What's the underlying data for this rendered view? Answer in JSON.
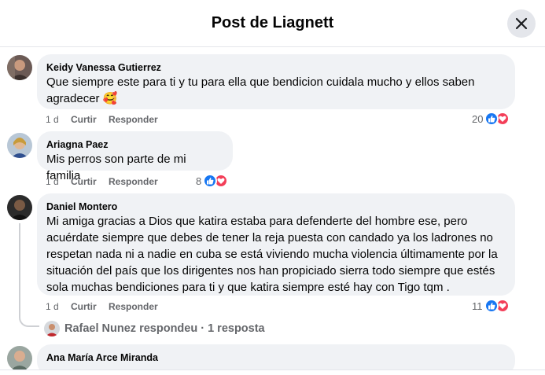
{
  "header": {
    "title": "Post de Liagnett"
  },
  "comments": [
    {
      "author": "Keidy Vanessa Gutierrez",
      "text_lines": [
        "Que siempre este para ti y tu para ella que bendicion cuidala mucho y ellos saben",
        "agradecer 🥰"
      ],
      "time": "1 d",
      "like_label": "Curtir",
      "reply_label": "Responder",
      "reaction_count": "20",
      "reactions": [
        "like-icon",
        "love-icon"
      ]
    },
    {
      "author": "Ariagna Paez",
      "text_lines": [
        "Mis perros son parte de mi familia"
      ],
      "time": "1 d",
      "like_label": "Curtir",
      "reply_label": "Responder",
      "reaction_count": "8",
      "reactions": [
        "like-icon",
        "love-icon"
      ]
    },
    {
      "author": "Daniel Montero",
      "text_lines": [
        "Mi amiga gracias a Dios que katira estaba para defenderte del hombre ese, pero",
        "acuérdate siempre que debes de tener la reja puesta con candado ya los ladrones no",
        "respetan nada ni a nadie en cuba se está viviendo mucha violencia últimamente por la",
        "situación del país que los dirigentes nos han propiciado sierra todo siempre que estés",
        "sola muchas bendiciones para ti y que katira siempre esté hay con Tigo tqm ."
      ],
      "time": "1 d",
      "like_label": "Curtir",
      "reply_label": "Responder",
      "reaction_count": "11",
      "reactions": [
        "like-icon",
        "love-icon"
      ],
      "replies_summary": "Rafael Nunez respondeu · 1 resposta"
    },
    {
      "author": "Ana María Arce Miranda",
      "text_lines": []
    }
  ],
  "colors": {
    "like": "#1877f2",
    "love": "#f33e58",
    "bubble": "#f0f2f5",
    "muted_text": "#65676b"
  }
}
